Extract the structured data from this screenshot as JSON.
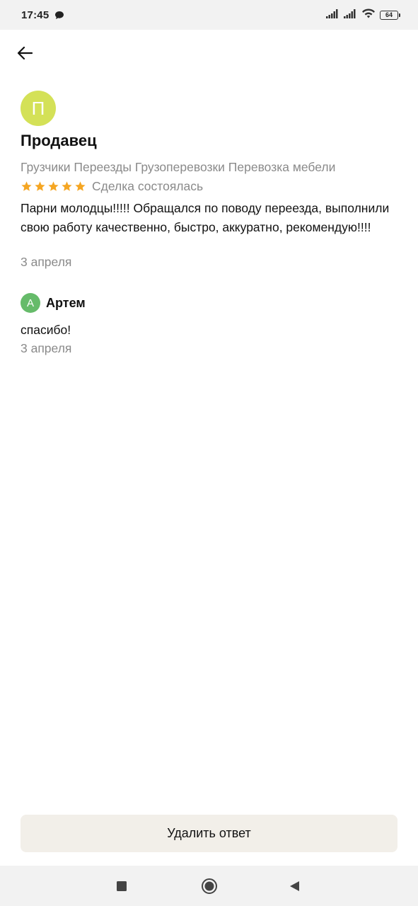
{
  "status_bar": {
    "time": "17:45",
    "battery": "64",
    "icons": [
      "message-icon",
      "signal-icon",
      "signal-icon",
      "wifi-icon",
      "battery-icon"
    ]
  },
  "header": {
    "back_icon": "arrow-left-icon"
  },
  "review": {
    "avatar_letter": "П",
    "avatar_color": "#d4e157",
    "author": "Продавец",
    "categories": "Грузчики Переезды Грузоперевозки Перевозка мебели",
    "rating": 5,
    "star_color": "#f5a623",
    "deal_status": "Сделка состоялась",
    "text": "Парни молодцы!!!!! Обращался по поводу переезда, выполнили свою работу качественно, быстро, аккуратно, рекомендую!!!!",
    "date": "3 апреля"
  },
  "reply": {
    "avatar_letter": "А",
    "avatar_color": "#66bb6a",
    "author": "Артем",
    "text": "спасибо!",
    "date": "3 апреля"
  },
  "actions": {
    "delete_label": "Удалить ответ"
  },
  "nav_bar": {
    "icons": [
      "square-recents-icon",
      "circle-home-icon",
      "triangle-back-icon"
    ]
  }
}
